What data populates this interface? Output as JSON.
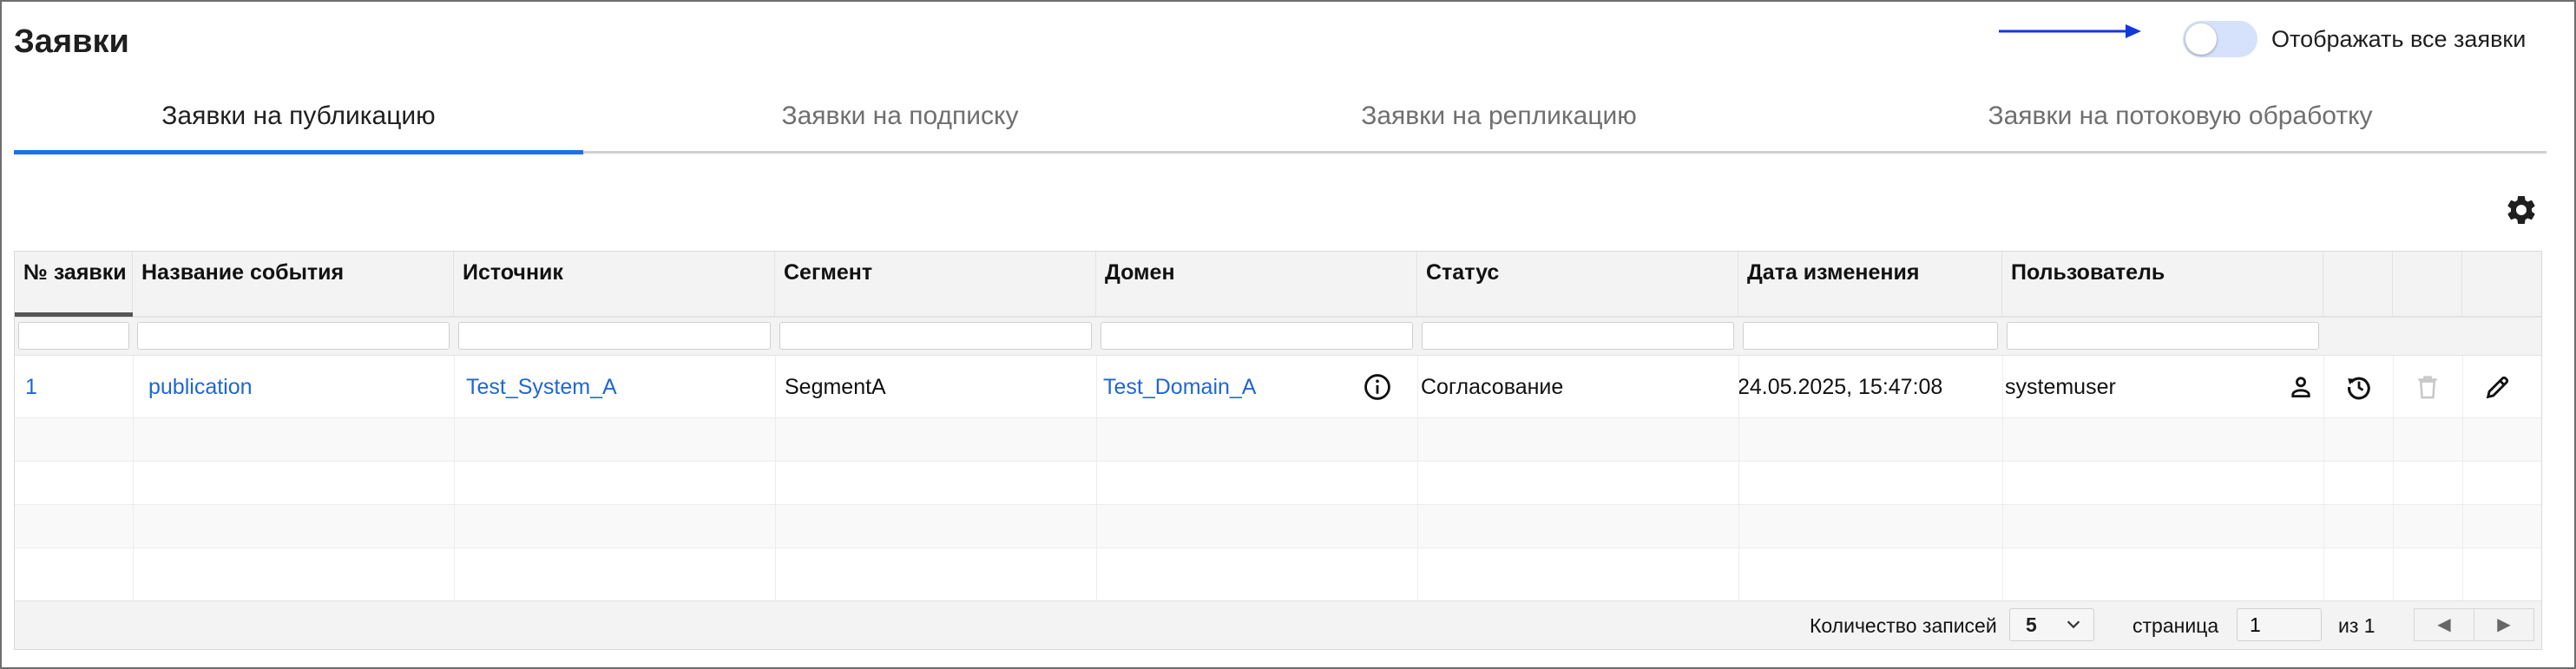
{
  "header": {
    "title": "Заявки",
    "toggle_label": "Отображать все заявки",
    "toggle_on": false
  },
  "tabs": [
    {
      "label": "Заявки на публикацию",
      "active": true
    },
    {
      "label": "Заявки на подписку",
      "active": false
    },
    {
      "label": "Заявки на репликацию",
      "active": false
    },
    {
      "label": "Заявки на потоковую обработку",
      "active": false
    }
  ],
  "table": {
    "columns": [
      "№ заявки",
      "Название события",
      "Источник",
      "Сегмент",
      "Домен",
      "Статус",
      "Дата изменения",
      "Пользователь"
    ],
    "rows": [
      {
        "id": "1",
        "event_name": "publication",
        "source": "Test_System_A",
        "segment": "SegmentA",
        "domain": "Test_Domain_A",
        "status": "Согласование",
        "date": "24.05.2025, 15:47:08",
        "user": "systemuser"
      }
    ]
  },
  "footer": {
    "records_label": "Количество записей",
    "records_per_page": "5",
    "page_label": "страница",
    "page_value": "1",
    "of_label": "из 1"
  },
  "colors": {
    "accent": "#1f6fe5",
    "link": "#1f66d6",
    "annotation_arrow": "#1238d8"
  },
  "icons": {
    "toolbar": "gear-icon",
    "domain_info": "info-icon",
    "row_actions": [
      "user-icon",
      "history-icon",
      "delete-icon",
      "edit-icon"
    ],
    "pager": [
      "chevron-left-icon",
      "chevron-right-icon"
    ]
  }
}
